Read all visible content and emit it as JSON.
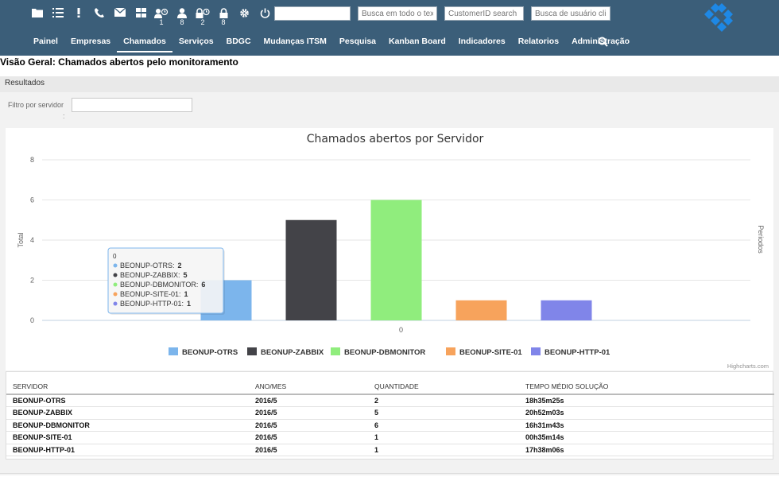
{
  "toolbar": {
    "icons": [
      {
        "name": "folder-icon",
        "count": ""
      },
      {
        "name": "list-icon",
        "count": ""
      },
      {
        "name": "exclamation-icon",
        "count": ""
      },
      {
        "name": "phone-icon",
        "count": ""
      },
      {
        "name": "envelope-icon",
        "count": ""
      },
      {
        "name": "grid-icon",
        "count": ""
      },
      {
        "name": "user-clock-icon",
        "count": "1"
      },
      {
        "name": "user-icon",
        "count": "8"
      },
      {
        "name": "lock-clock-icon",
        "count": "2"
      },
      {
        "name": "lock-icon",
        "count": "8"
      },
      {
        "name": "gear-icon",
        "count": ""
      },
      {
        "name": "power-icon",
        "count": ""
      }
    ],
    "search_main": {
      "value": "",
      "placeholder": ""
    },
    "search_text": {
      "placeholder": "Busca em todo o texto"
    },
    "search_customer": {
      "placeholder": "CustomerID search"
    },
    "search_user": {
      "placeholder": "Busca de usuário cliente"
    }
  },
  "nav": {
    "items": [
      "Painel",
      "Empresas",
      "Chamados",
      "Serviços",
      "BDGC",
      "Mudanças ITSM",
      "Pesquisa",
      "Kanban Board",
      "Indicadores",
      "Relatorios",
      "Administração"
    ],
    "active": "Chamados"
  },
  "page": {
    "title": "Visão Geral: Chamados abertos pelo monitoramento",
    "results_label": "Resultados",
    "filter_label": "Filtro por servidor",
    "filter_colon": ":",
    "filter_value": ""
  },
  "colors": {
    "topbar": "#3b5e79",
    "series": [
      "#7cb5ec",
      "#434348",
      "#90ed7d",
      "#f7a35c",
      "#8085e9"
    ]
  },
  "chart_data": {
    "type": "bar",
    "title": "Chamados abertos por Servidor",
    "ylabel": "Total",
    "ylabel_right": "Periodos",
    "categories": [
      "0"
    ],
    "ylim": [
      0,
      8
    ],
    "yticks": [
      0,
      2,
      4,
      6,
      8
    ],
    "grid": true,
    "legend_position": "bottom",
    "series": [
      {
        "name": "BEONUP-OTRS",
        "values": [
          2
        ],
        "color": "#7cb5ec"
      },
      {
        "name": "BEONUP-ZABBIX",
        "values": [
          5
        ],
        "color": "#434348"
      },
      {
        "name": "BEONUP-DBMONITOR",
        "values": [
          6
        ],
        "color": "#90ed7d"
      },
      {
        "name": "BEONUP-SITE-01",
        "values": [
          1
        ],
        "color": "#f7a35c"
      },
      {
        "name": "BEONUP-HTTP-01",
        "values": [
          1
        ],
        "color": "#8085e9"
      }
    ],
    "tooltip": {
      "header": "0"
    },
    "credits": "Highcharts.com"
  },
  "table": {
    "columns": [
      "SERVIDOR",
      "ANO/MES",
      "QUANTIDADE",
      "TEMPO MÉDIO SOLUÇÃO"
    ],
    "rows": [
      [
        "BEONUP-OTRS",
        "2016/5",
        "2",
        "18h35m25s"
      ],
      [
        "BEONUP-ZABBIX",
        "2016/5",
        "5",
        "20h52m03s"
      ],
      [
        "BEONUP-DBMONITOR",
        "2016/5",
        "6",
        "16h31m43s"
      ],
      [
        "BEONUP-SITE-01",
        "2016/5",
        "1",
        "00h35m14s"
      ],
      [
        "BEONUP-HTTP-01",
        "2016/5",
        "1",
        "17h38m06s"
      ]
    ]
  }
}
